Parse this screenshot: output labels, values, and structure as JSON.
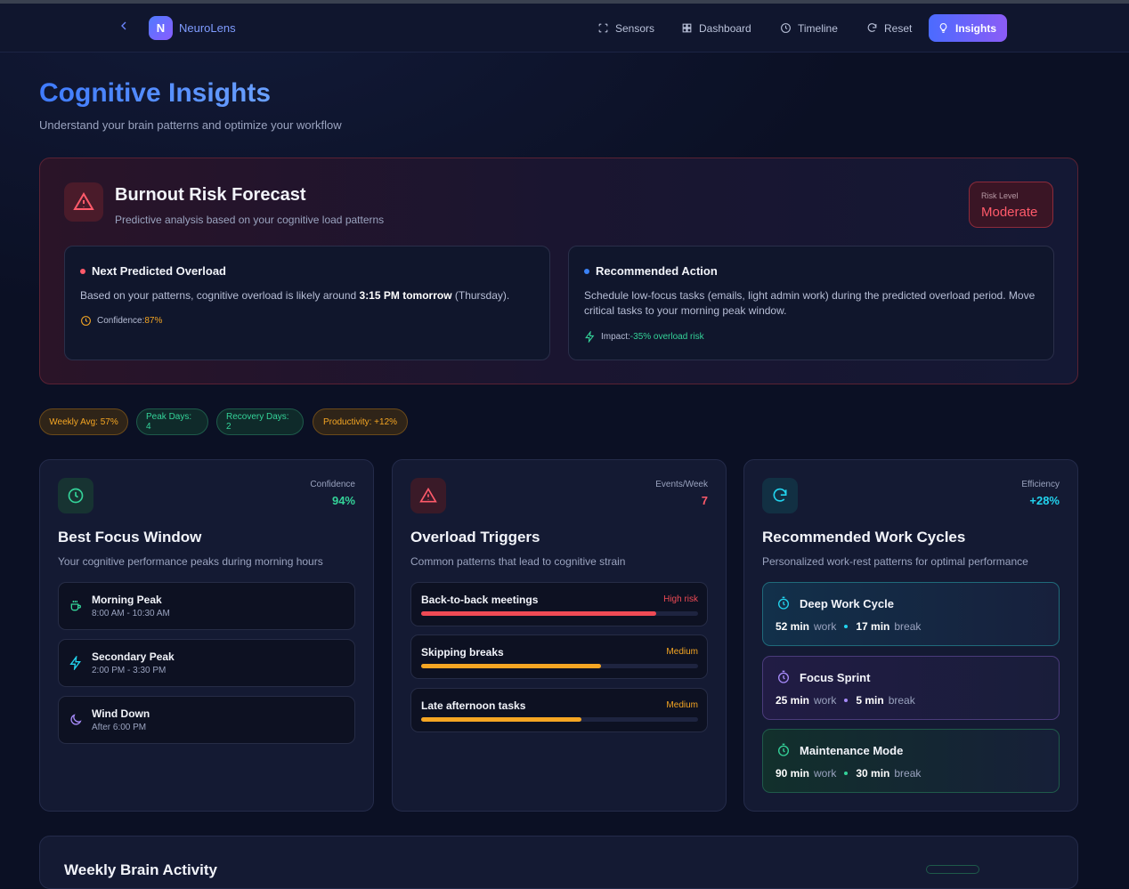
{
  "nav": {
    "brand_initial": "N",
    "brand": "NeuroLens",
    "items": [
      {
        "label": "Sensors",
        "icon": "scan-icon"
      },
      {
        "label": "Dashboard",
        "icon": "grid-icon"
      },
      {
        "label": "Timeline",
        "icon": "clock-icon"
      },
      {
        "label": "Reset",
        "icon": "refresh-icon"
      },
      {
        "label": "Insights",
        "icon": "lightbulb-icon",
        "active": true
      }
    ]
  },
  "header": {
    "title": "Cognitive Insights",
    "subtitle": "Understand your brain patterns and optimize your workflow"
  },
  "burnout": {
    "title": "Burnout Risk Forecast",
    "subtitle": "Predictive analysis based on your cognitive load patterns",
    "risk_label": "Risk Level",
    "risk_value": "Moderate",
    "overload": {
      "title": "Next Predicted Overload",
      "text_pre": "Based on your patterns, cognitive overload is likely around ",
      "text_bold": "3:15 PM tomorrow",
      "text_post": " (Thursday).",
      "meta_label": "Confidence: ",
      "meta_value": "87%"
    },
    "action": {
      "title": "Recommended Action",
      "text": "Schedule low-focus tasks (emails, light admin work) during the predicted overload period. Move critical tasks to your morning peak window.",
      "meta_label": "Impact: ",
      "meta_value": "-35% overload risk"
    }
  },
  "pills": [
    {
      "label": "Weekly Avg: 57%",
      "tone": "orange"
    },
    {
      "label": "Peak Days: 4",
      "tone": "green"
    },
    {
      "label": "Recovery Days: 2",
      "tone": "green"
    },
    {
      "label": "Productivity: +12%",
      "tone": "orange"
    }
  ],
  "focus": {
    "metric_label": "Confidence",
    "metric_value": "94%",
    "title": "Best Focus Window",
    "subtitle": "Your cognitive performance peaks during morning hours",
    "windows": [
      {
        "name": "Morning Peak",
        "time": "8:00 AM - 10:30 AM",
        "icon": "coffee-icon"
      },
      {
        "name": "Secondary Peak",
        "time": "2:00 PM - 3:30 PM",
        "icon": "bolt-icon"
      },
      {
        "name": "Wind Down",
        "time": "After 6:00 PM",
        "icon": "moon-icon"
      }
    ]
  },
  "triggers": {
    "metric_label": "Events/Week",
    "metric_value": "7",
    "title": "Overload Triggers",
    "subtitle": "Common patterns that lead to cognitive strain",
    "items": [
      {
        "name": "Back-to-back meetings",
        "level": "High risk",
        "fraction": 0.85,
        "color": "#ef4a55"
      },
      {
        "name": "Skipping breaks",
        "level": "Medium",
        "fraction": 0.65,
        "color": "#f5a623"
      },
      {
        "name": "Late afternoon tasks",
        "level": "Medium",
        "fraction": 0.58,
        "color": "#f5a623"
      }
    ]
  },
  "cycles": {
    "metric_label": "Efficiency",
    "metric_value": "+28%",
    "title": "Recommended Work Cycles",
    "subtitle": "Personalized work-rest patterns for optimal performance",
    "items": [
      {
        "name": "Deep Work Cycle",
        "work": "52 min",
        "work_label": "work",
        "rest": "17 min",
        "rest_label": "break",
        "color": "#22d3ee"
      },
      {
        "name": "Focus Sprint",
        "work": "25 min",
        "work_label": "work",
        "rest": "5 min",
        "rest_label": "break",
        "color": "#a78bfa"
      },
      {
        "name": "Maintenance Mode",
        "work": "90 min",
        "work_label": "work",
        "rest": "30 min",
        "rest_label": "break",
        "color": "#34d399"
      }
    ]
  },
  "weekly": {
    "title": "Weekly Brain Activity"
  },
  "colors": {
    "accent": "#4f86ff",
    "danger": "#ff5a6a",
    "warning": "#f5a623",
    "success": "#34d399",
    "cyan": "#22d3ee"
  }
}
